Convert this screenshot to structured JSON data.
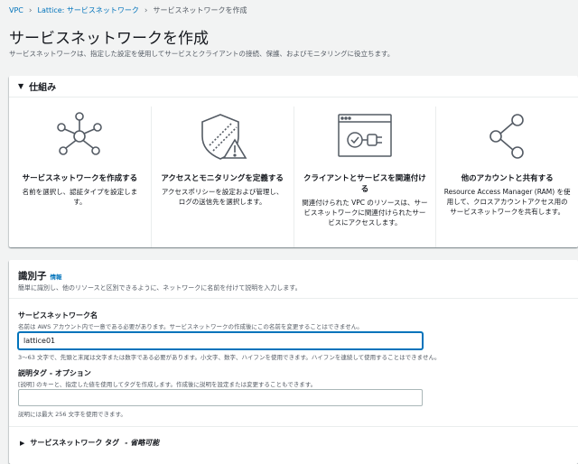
{
  "breadcrumb": {
    "items": [
      "VPC",
      "Lattice: サービスネットワーク",
      "サービスネットワークを作成"
    ]
  },
  "page": {
    "title": "サービスネットワークを作成",
    "description": "サービスネットワークは、指定した設定を使用してサービスとクライアントの接続、保護、およびモニタリングに役立ちます。"
  },
  "how_it_works": {
    "header": "仕組み",
    "columns": [
      {
        "icon": "network-hub-icon",
        "title": "サービスネットワークを作成する",
        "text": "名前を選択し、認証タイプを設定します。"
      },
      {
        "icon": "shield-warning-icon",
        "title": "アクセスとモニタリングを定義する",
        "text": "アクセスポリシーを設定および管理し、ログの送信先を選択します。"
      },
      {
        "icon": "browser-connect-icon",
        "title": "クライアントとサービスを関連付ける",
        "text": "関連付けられた VPC のリソースは、サービスネットワークに関連付けられたサービスにアクセスします。"
      },
      {
        "icon": "share-icon",
        "title": "他のアカウントと共有する",
        "text": "Resource Access Manager (RAM) を使用して、クロスアカウントアクセス用のサービスネットワークを共有します。"
      }
    ]
  },
  "identifiers": {
    "title": "識別子",
    "info": "情報",
    "description": "簡単に識別し、他のリソースと区別できるように、ネットワークに名前を付けて説明を入力します。",
    "name_field": {
      "label": "サービスネットワーク名",
      "description": "名前は AWS アカウント内で一意である必要があります。サービスネットワークの作成後にこの名前を変更することはできません。",
      "value": "lattice01",
      "constraint": "3〜63 文字で、先頭と末尾は文字または数字である必要があります。小文字、数字、ハイフンを使用できます。ハイフンを連続して使用することはできません。"
    },
    "desc_field": {
      "label": "説明タグ - オプション",
      "description": "[説明] のキーと、指定した値を使用してタグを作成します。作成後に説明を設定または変更することもできます。",
      "value": "",
      "constraint": "説明には最大 256 文字を使用できます。"
    },
    "tags_expander": {
      "label": "サービスネットワーク タグ",
      "optional": "- 省略可能"
    }
  },
  "colors": {
    "link": "#0073bb",
    "background": "#f2f3f3",
    "text": "#16191f",
    "secondary_text": "#545b64"
  }
}
